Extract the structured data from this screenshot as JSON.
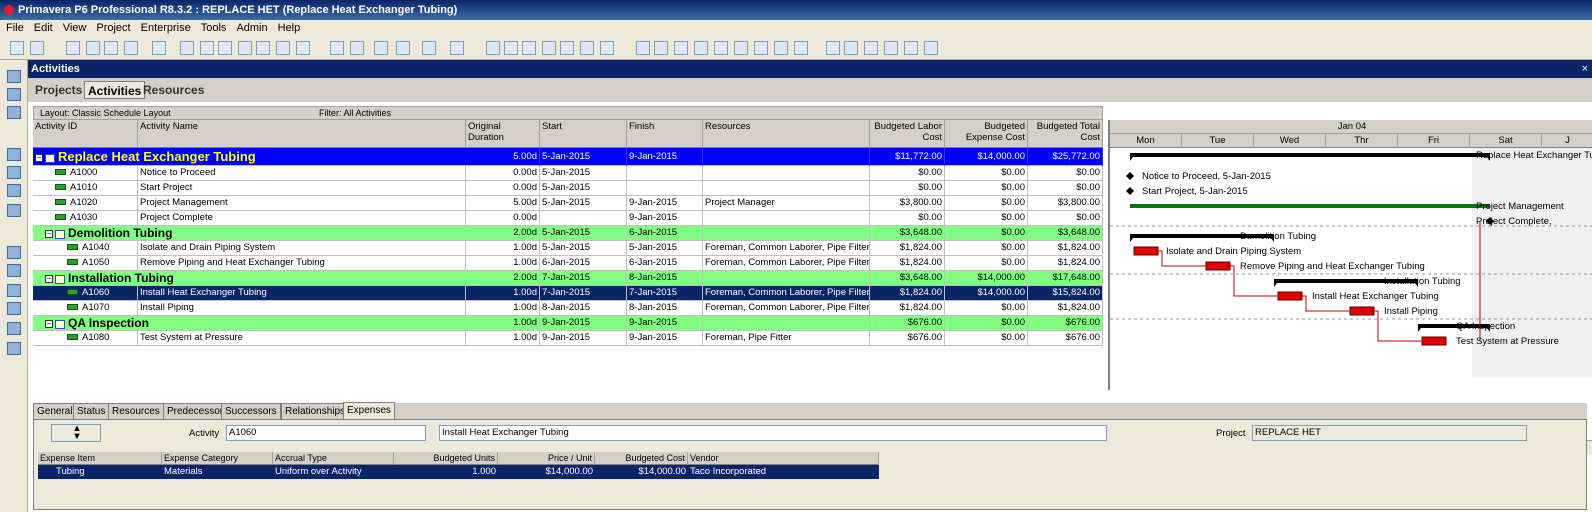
{
  "app": {
    "title": "Primavera P6 Professional R8.3.2 : REPLACE HET (Replace Heat Exchanger Tubing)"
  },
  "menu": [
    "File",
    "Edit",
    "View",
    "Project",
    "Enterprise",
    "Tools",
    "Admin",
    "Help"
  ],
  "window": {
    "title": "Activities",
    "close": "×",
    "tabs": [
      "Projects",
      "Activities",
      "Resources"
    ]
  },
  "layout": {
    "label": "Layout: Classic Schedule Layout",
    "filter": "Filter: All Activities"
  },
  "columns": [
    "Activity ID",
    "Activity Name",
    "Original Duration",
    "Start",
    "Finish",
    "Resources",
    "Budgeted Labor Cost",
    "Budgeted Expense Cost",
    "Budgeted Total Cost"
  ],
  "rows": [
    {
      "kind": "proj",
      "id": "",
      "name": "Replace Heat Exchanger Tubing",
      "dur": "5.00d",
      "start": "5-Jan-2015",
      "finish": "9-Jan-2015",
      "res": "",
      "labor": "$11,772.00",
      "expense": "$14,000.00",
      "total": "$25,772.00"
    },
    {
      "kind": "act",
      "id": "A1000",
      "name": "Notice to Proceed",
      "dur": "0.00d",
      "start": "5-Jan-2015",
      "finish": "",
      "res": "",
      "labor": "$0.00",
      "expense": "$0.00",
      "total": "$0.00"
    },
    {
      "kind": "act",
      "id": "A1010",
      "name": "Start Project",
      "dur": "0.00d",
      "start": "5-Jan-2015",
      "finish": "",
      "res": "",
      "labor": "$0.00",
      "expense": "$0.00",
      "total": "$0.00"
    },
    {
      "kind": "act",
      "id": "A1020",
      "name": "Project Management",
      "dur": "5.00d",
      "start": "5-Jan-2015",
      "finish": "9-Jan-2015",
      "res": "Project Manager",
      "labor": "$3,800.00",
      "expense": "$0.00",
      "total": "$3,800.00"
    },
    {
      "kind": "act",
      "id": "A1030",
      "name": "Project Complete",
      "dur": "0.00d",
      "start": "",
      "finish": "9-Jan-2015",
      "res": "",
      "labor": "$0.00",
      "expense": "$0.00",
      "total": "$0.00"
    },
    {
      "kind": "wbs",
      "id": "",
      "name": "Demolition Tubing",
      "dur": "2.00d",
      "start": "5-Jan-2015",
      "finish": "6-Jan-2015",
      "res": "",
      "labor": "$3,648.00",
      "expense": "$0.00",
      "total": "$3,648.00"
    },
    {
      "kind": "act2",
      "id": "A1040",
      "name": "Isolate and Drain Piping System",
      "dur": "1.00d",
      "start": "5-Jan-2015",
      "finish": "5-Jan-2015",
      "res": "Foreman, Common Laborer, Pipe Filter",
      "labor": "$1,824.00",
      "expense": "$0.00",
      "total": "$1,824.00"
    },
    {
      "kind": "act2",
      "id": "A1050",
      "name": "Remove Piping and Heat Exchanger Tubing",
      "dur": "1.00d",
      "start": "6-Jan-2015",
      "finish": "6-Jan-2015",
      "res": "Foreman, Common Laborer, Pipe Filter",
      "labor": "$1,824.00",
      "expense": "$0.00",
      "total": "$1,824.00"
    },
    {
      "kind": "wbs",
      "id": "",
      "name": "Installation Tubing",
      "dur": "2.00d",
      "start": "7-Jan-2015",
      "finish": "8-Jan-2015",
      "res": "",
      "labor": "$3,648.00",
      "expense": "$14,000.00",
      "total": "$17,648.00"
    },
    {
      "kind": "sel",
      "id": "A1060",
      "name": "Install Heat Exchanger Tubing",
      "dur": "1.00d",
      "start": "7-Jan-2015",
      "finish": "7-Jan-2015",
      "res": "Foreman, Common Laborer, Pipe Filter",
      "labor": "$1,824.00",
      "expense": "$14,000.00",
      "total": "$15,824.00"
    },
    {
      "kind": "act2",
      "id": "A1070",
      "name": "Install Piping",
      "dur": "1.00d",
      "start": "8-Jan-2015",
      "finish": "8-Jan-2015",
      "res": "Foreman, Common Laborer, Pipe Filter",
      "labor": "$1,824.00",
      "expense": "$0.00",
      "total": "$1,824.00"
    },
    {
      "kind": "wbs",
      "id": "",
      "name": "QA Inspection",
      "dur": "1.00d",
      "start": "9-Jan-2015",
      "finish": "9-Jan-2015",
      "res": "",
      "labor": "$676.00",
      "expense": "$0.00",
      "total": "$676.00"
    },
    {
      "kind": "act2",
      "id": "A1080",
      "name": "Test System at Pressure",
      "dur": "1.00d",
      "start": "9-Jan-2015",
      "finish": "9-Jan-2015",
      "res": "Foreman, Pipe Fitter",
      "labor": "$676.00",
      "expense": "$0.00",
      "total": "$676.00"
    }
  ],
  "gantt": {
    "month": "Jan 04",
    "days": [
      "Mon",
      "Tue",
      "Wed",
      "Thr",
      "Fri",
      "Sat",
      "J"
    ],
    "labels": [
      "Replace Heat Exchanger Tub",
      "Notice to Proceed, 5-Jan-2015",
      "Start Project, 5-Jan-2015",
      "Project Management",
      "Project Complete,",
      "Demolition Tubing",
      "Isolate and Drain Piping System",
      "Remove Piping and Heat Exchanger Tubing",
      "Installation Tubing",
      "Install Heat Exchanger Tubing",
      "Install Piping",
      "QA Inspection",
      "Test System at Pressure"
    ]
  },
  "bottom": {
    "tabs": [
      "General",
      "Status",
      "Resources",
      "Predecessors",
      "Successors",
      "Relationships",
      "Expenses"
    ],
    "activity_label": "Activity",
    "activity_id": "A1060",
    "activity_name": "Install Heat Exchanger Tubing",
    "project_label": "Project",
    "project_id": "REPLACE HET",
    "exp_cols": [
      "Expense Item",
      "Expense Category",
      "Accrual Type",
      "Budgeted Units",
      "Price / Unit",
      "Budgeted Cost",
      "Vendor"
    ],
    "exp_row": [
      "Tubing",
      "Materials",
      "Uniform over Activity",
      "1.000",
      "$14,000.00",
      "$14,000.00",
      "Taco Incorporated"
    ]
  }
}
